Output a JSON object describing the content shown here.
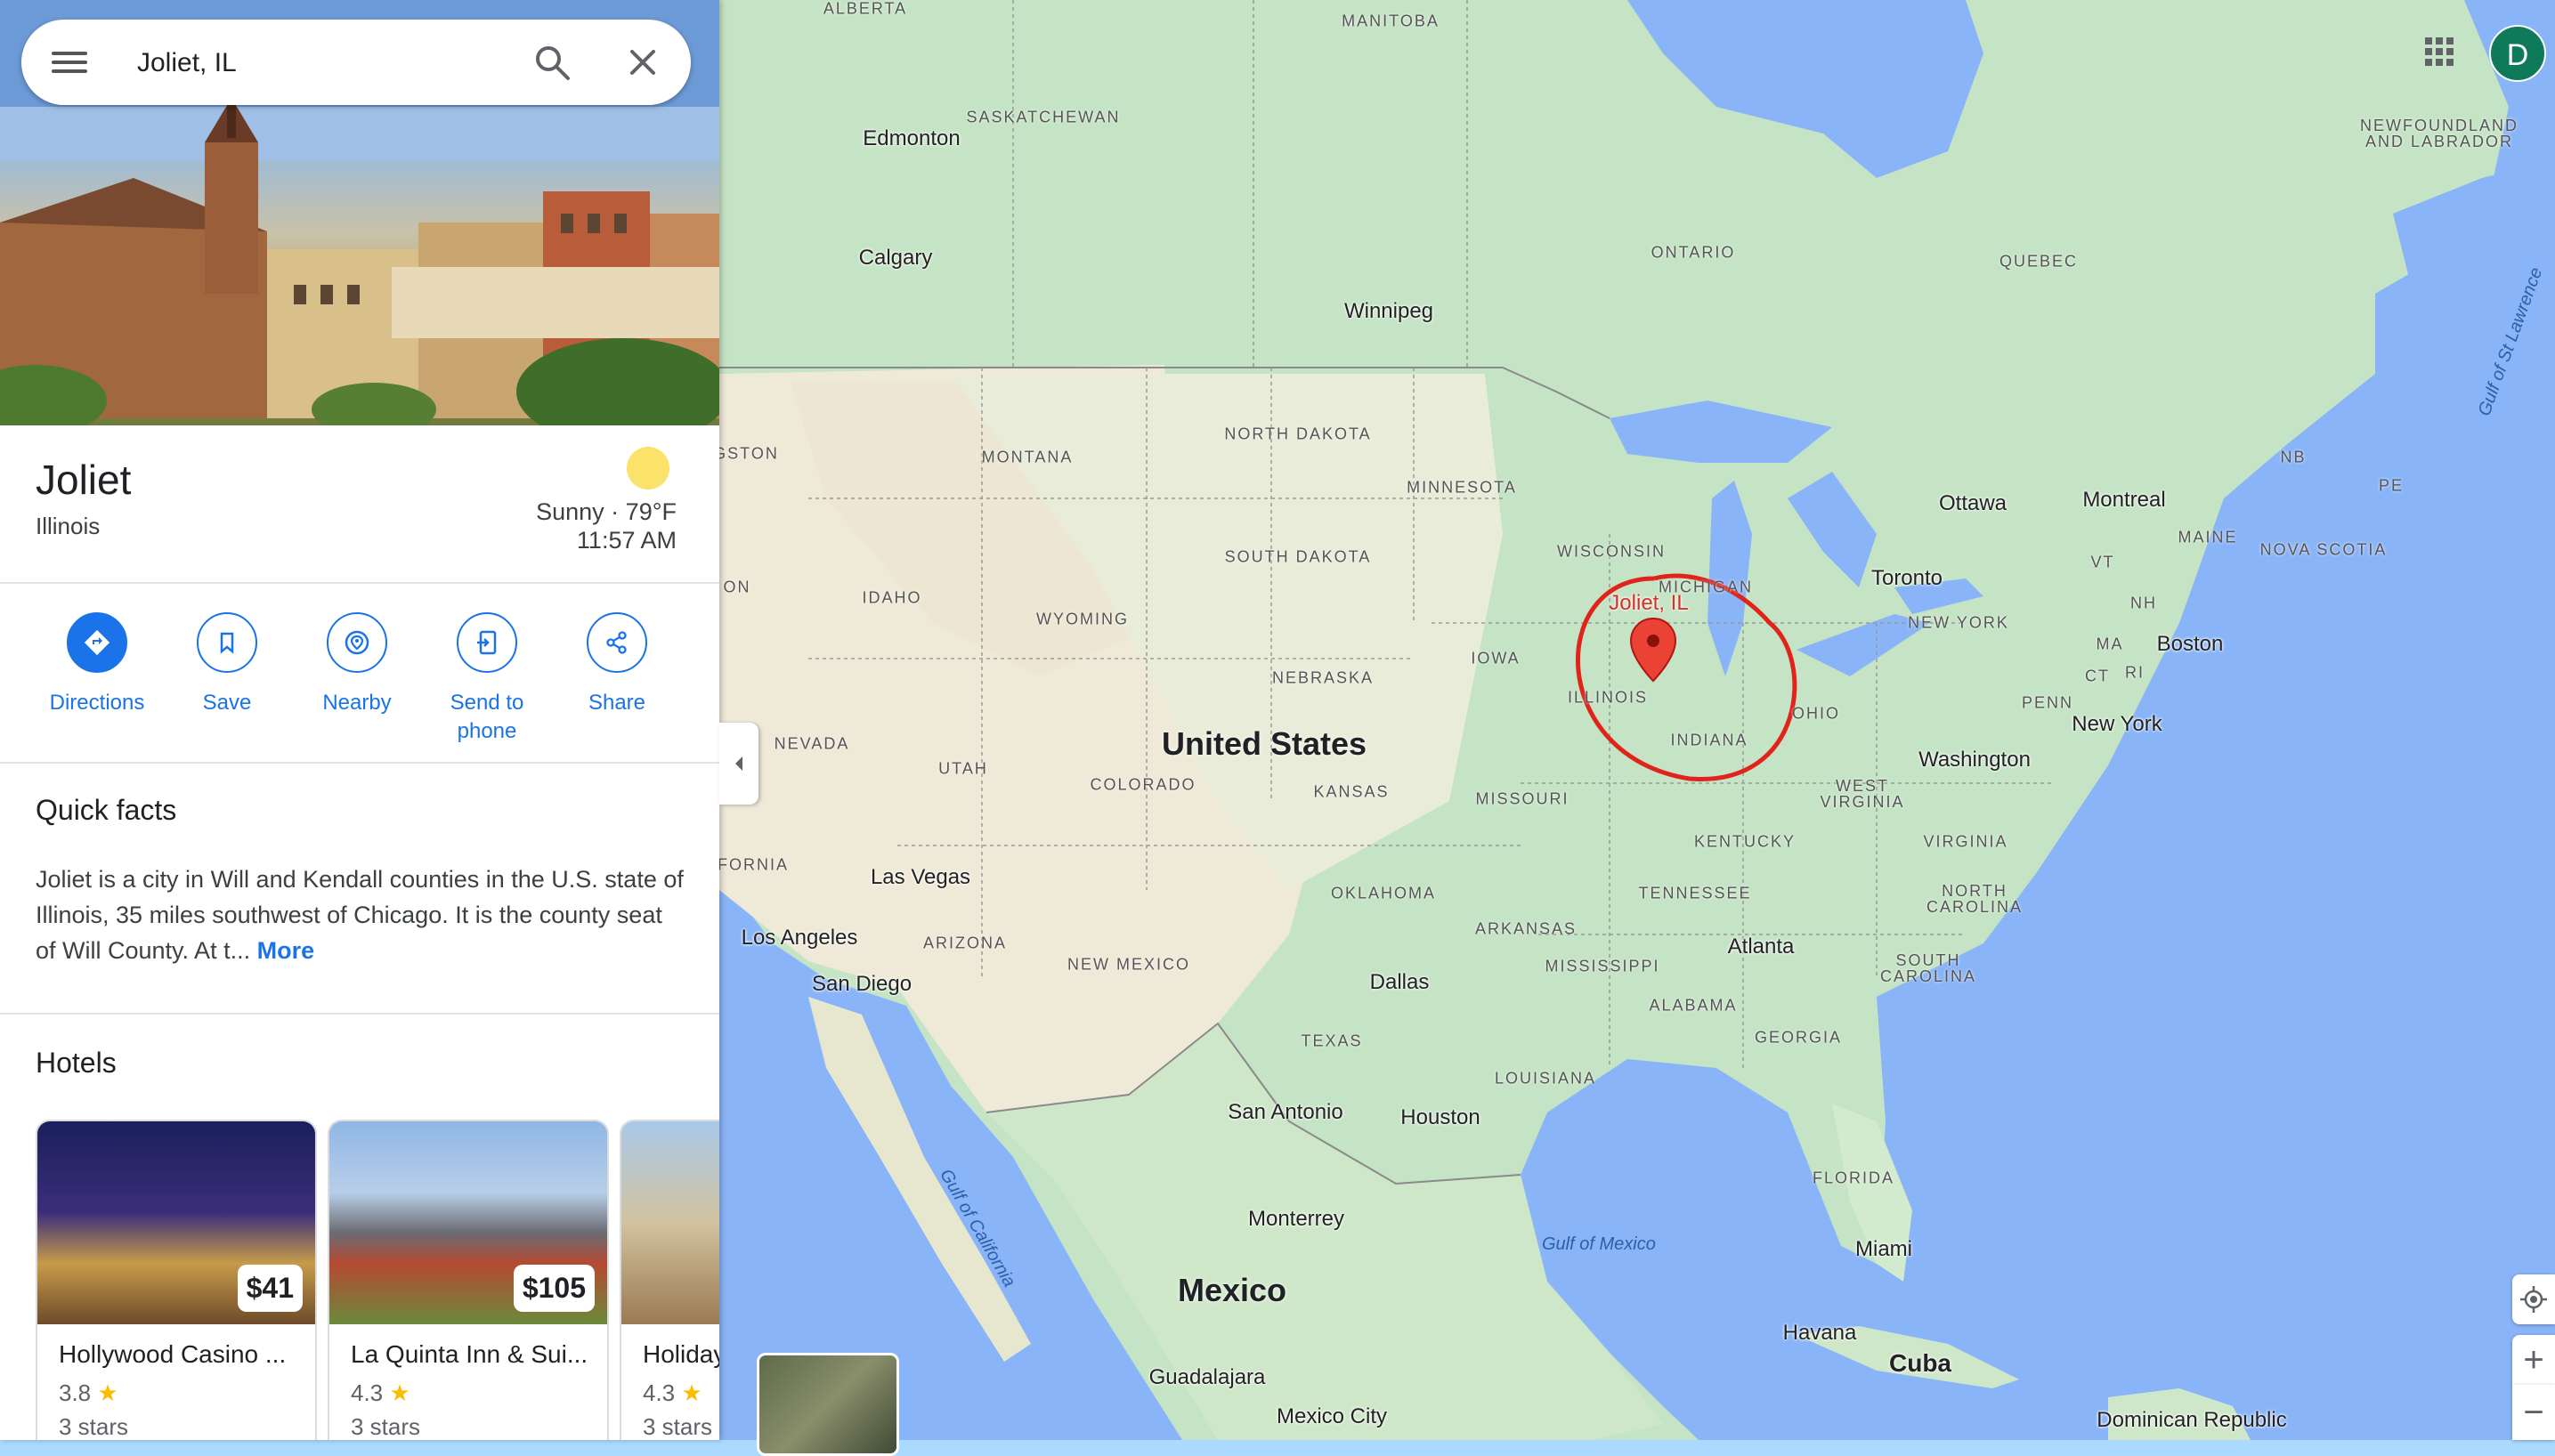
{
  "search": {
    "value": "Joliet, IL",
    "menu_icon": "menu-icon",
    "search_icon": "search-icon",
    "close_icon": "close-icon"
  },
  "place": {
    "name": "Joliet",
    "subtitle": "Illinois",
    "weather": {
      "condition": "Sunny · 79°F",
      "time": "11:57 AM",
      "icon": "sun-icon"
    }
  },
  "actions": [
    {
      "label": "Directions",
      "icon": "directions-icon"
    },
    {
      "label": "Save",
      "icon": "bookmark-icon"
    },
    {
      "label": "Nearby",
      "icon": "nearby-icon"
    },
    {
      "label": "Send to phone",
      "icon": "send-to-phone-icon"
    },
    {
      "label": "Share",
      "icon": "share-icon"
    }
  ],
  "quick_facts": {
    "heading": "Quick facts",
    "text": "Joliet is a city in Will and Kendall counties in the U.S. state of Illinois, 35 miles southwest of Chicago. It is the county seat of Will County. At t...",
    "more": "More"
  },
  "hotels": {
    "heading": "Hotels",
    "items": [
      {
        "name": "Hollywood Casino ...",
        "price": "$41",
        "rating": "3.8",
        "class": "3 stars"
      },
      {
        "name": "La Quinta Inn & Sui...",
        "price": "$105",
        "rating": "4.3",
        "class": "3 stars"
      },
      {
        "name": "Holiday",
        "price": "",
        "rating": "4.3",
        "class": "3 stars"
      }
    ]
  },
  "map": {
    "country_labels": [
      "United States",
      "Mexico",
      "Cuba"
    ],
    "cities": [
      "Edmonton",
      "Calgary",
      "Winnipeg",
      "Ottawa",
      "Montreal",
      "Toronto",
      "Boston",
      "New York",
      "Washington",
      "Atlanta",
      "Miami",
      "Havana",
      "Dallas",
      "Houston",
      "San Antonio",
      "Monterrey",
      "Guadalajara",
      "Mexico City",
      "Las Vegas",
      "Los Angeles",
      "San Diego",
      "Dominican Republic"
    ],
    "regions": [
      "ALBERTA",
      "MANITOBA",
      "SASKATCHEWAN",
      "ONTARIO",
      "QUEBEC",
      "NEWFOUNDLAND AND LABRADOR",
      "NORTH DAKOTA",
      "MONTANA",
      "MINNESOTA",
      "SOUTH DAKOTA",
      "WISCONSIN",
      "MICHIGAN",
      "IDAHO",
      "WYOMING",
      "IOWA",
      "NEBRASKA",
      "ILLINOIS",
      "INDIANA",
      "OHIO",
      "NEVADA",
      "UTAH",
      "COLORADO",
      "KANSAS",
      "MISSOURI",
      "KENTUCKY",
      "WEST VIRGINIA",
      "VIRGINIA",
      "TENNESSEE",
      "NORTH CAROLINA",
      "SOUTH CAROLINA",
      "OKLAHOMA",
      "ARKANSAS",
      "MISSISSIPPI",
      "ALABAMA",
      "GEORGIA",
      "LOUISIANA",
      "TEXAS",
      "NEW MEXICO",
      "ARIZONA",
      "FLORIDA",
      "PENN",
      "NEW YORK",
      "MAINE",
      "NOVA SCOTIA",
      "NB",
      "PE",
      "VT",
      "NH",
      "MA",
      "CT",
      "RI",
      "ON",
      "FORNIA",
      "GSTON"
    ],
    "water": [
      "Gulf of Mexico",
      "Gulf of California",
      "Gulf of St Lawrence"
    ],
    "pin_label": "Joliet, IL",
    "accent_color": "#1a73e8",
    "annotation_color": "#e0241b"
  },
  "controls": {
    "apps_icon": "apps-grid-icon",
    "avatar": "D",
    "collapse_icon": "chevron-left-icon",
    "locate_icon": "my-location-icon",
    "zoom_in": "+",
    "zoom_out": "−",
    "layers_icon": "layers-thumbnail"
  }
}
